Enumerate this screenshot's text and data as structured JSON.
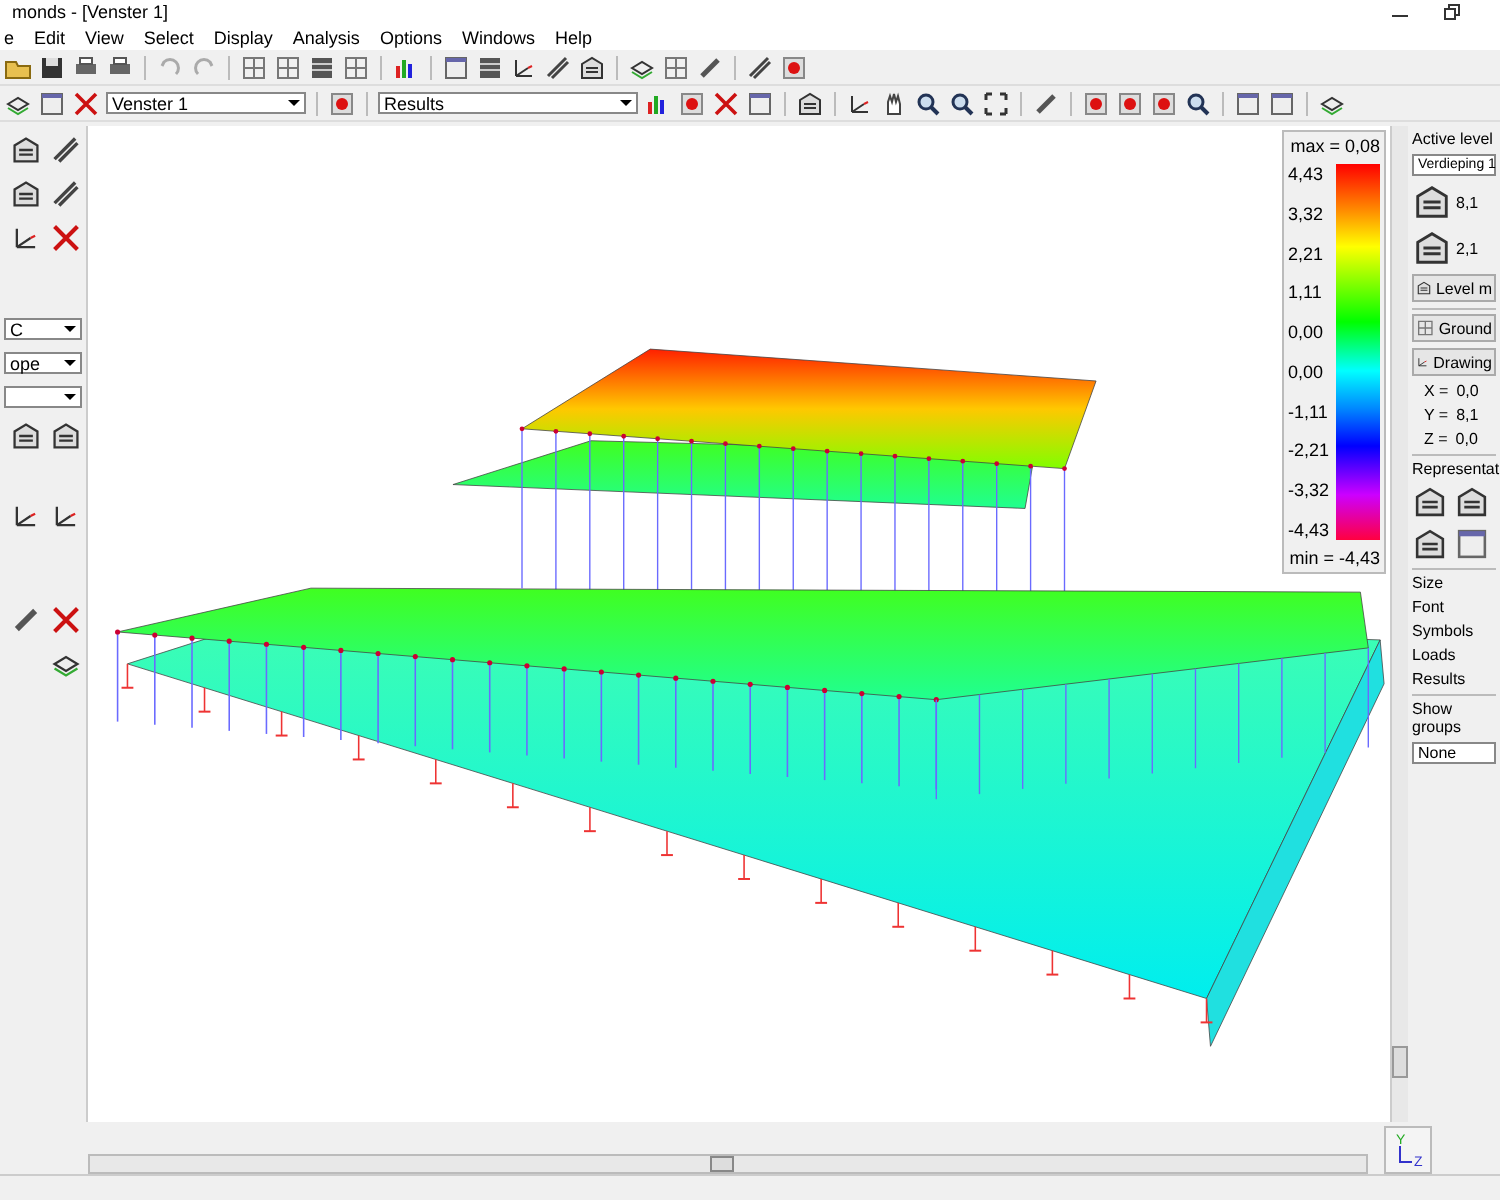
{
  "window": {
    "title": "monds - [Venster 1]"
  },
  "menu": [
    {
      "label": "e"
    },
    {
      "label": "Edit"
    },
    {
      "label": "View"
    },
    {
      "label": "Select"
    },
    {
      "label": "Display"
    },
    {
      "label": "Analysis"
    },
    {
      "label": "Options"
    },
    {
      "label": "Windows"
    },
    {
      "label": "Help"
    }
  ],
  "toolbar": {
    "window_dropdown": "Venster 1",
    "result_dropdown": "Results"
  },
  "left_panel": {
    "dropdowns": [
      "C",
      "ope"
    ]
  },
  "legend": {
    "max": "max = 0,08",
    "ticks": [
      "4,43",
      "3,32",
      "2,21",
      "1,11",
      "0,00",
      "0,00",
      "-1,11",
      "-2,21",
      "-3,32",
      "-4,43"
    ],
    "min": "min = -4,43"
  },
  "right_panel": {
    "active_level_title": "Active level",
    "level_dropdown": "Verdieping 1",
    "level_values": [
      "8,1",
      "2,1"
    ],
    "level_button": "Level m",
    "ground_button": "Ground",
    "drawing_button": "Drawing",
    "coordinates": [
      {
        "axis": "X =",
        "value": "0,0"
      },
      {
        "axis": "Y =",
        "value": "8,1"
      },
      {
        "axis": "Z =",
        "value": "0,0"
      }
    ],
    "representation_title": "Representat",
    "size_title": "Size",
    "size_labels": [
      "Font",
      "Symbols",
      "Loads",
      "Results"
    ],
    "groups_title": "Show groups",
    "groups_dropdown": "None"
  },
  "axis_indicator": {
    "labels": [
      "Y",
      "Z"
    ]
  }
}
